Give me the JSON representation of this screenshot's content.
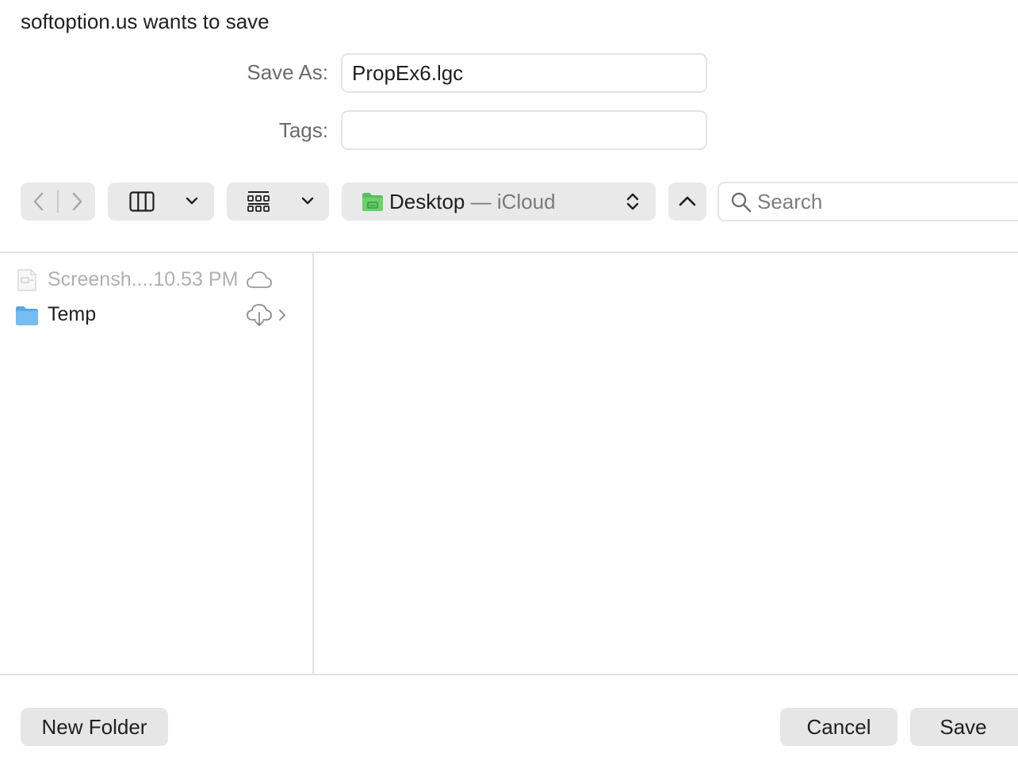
{
  "dialog": {
    "title": "softoption.us wants to save"
  },
  "form": {
    "save_as_label": "Save As:",
    "save_as_value": "PropEx6.lgc",
    "tags_label": "Tags:",
    "tags_value": ""
  },
  "toolbar": {
    "back_icon": "chevron-left-icon",
    "forward_icon": "chevron-right-icon",
    "view_icon": "column-view-icon",
    "group_icon": "grid-view-icon",
    "location": {
      "name": "Desktop",
      "separator": "—",
      "provider": "iCloud",
      "icon": "folder-icon",
      "icon_color": "#5bbd5f"
    },
    "up_icon": "chevron-up-icon",
    "search": {
      "placeholder": "Search",
      "icon": "search-icon"
    }
  },
  "files": [
    {
      "name": "Screensh....10.53 PM",
      "icon": "image-file-icon",
      "status_icon": "cloud-icon",
      "dimmed": true
    },
    {
      "name": "Temp",
      "icon": "folder-icon",
      "status_icon": "cloud-download-icon",
      "dimmed": false,
      "has_children": true
    }
  ],
  "colors": {
    "folder": "#6db3ea",
    "button_bg": "#e6e6e6"
  },
  "buttons": {
    "new_folder": "New Folder",
    "cancel": "Cancel",
    "save": "Save"
  }
}
